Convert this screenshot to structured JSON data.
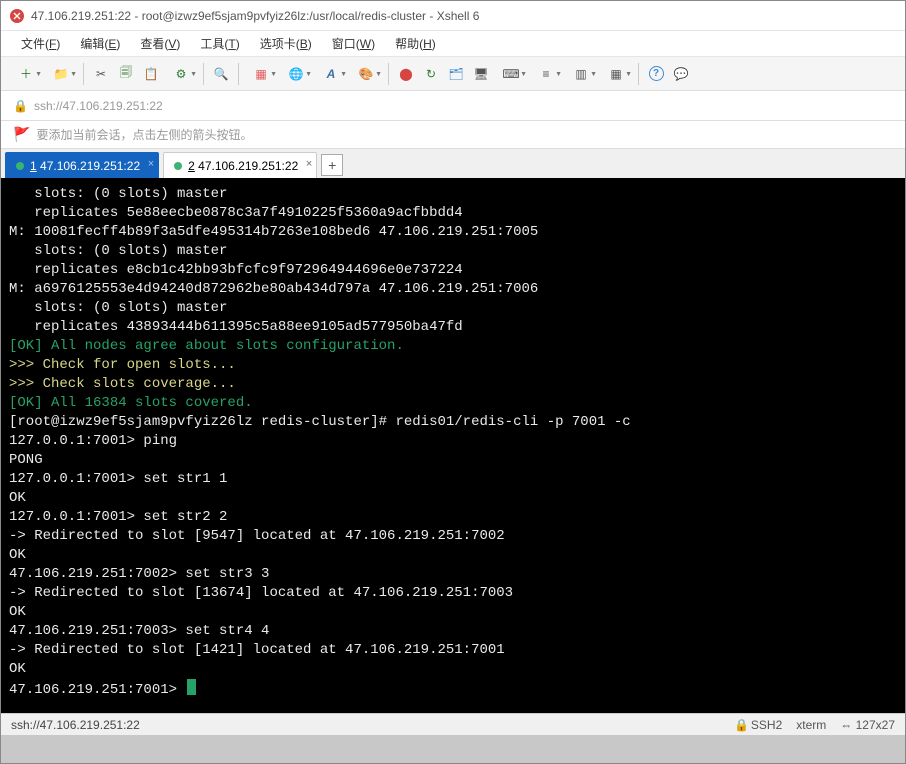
{
  "window": {
    "title": "47.106.219.251:22 - root@izwz9ef5sjam9pvfyiz26lz:/usr/local/redis-cluster - Xshell 6"
  },
  "menu": {
    "file": {
      "pre": "文件(",
      "key": "F",
      "post": ")"
    },
    "edit": {
      "pre": "编辑(",
      "key": "E",
      "post": ")"
    },
    "view": {
      "pre": "查看(",
      "key": "V",
      "post": ")"
    },
    "tools": {
      "pre": "工具(",
      "key": "T",
      "post": ")"
    },
    "tabs": {
      "pre": "选项卡(",
      "key": "B",
      "post": ")"
    },
    "window": {
      "pre": "窗口(",
      "key": "W",
      "post": ")"
    },
    "help": {
      "pre": "帮助(",
      "key": "H",
      "post": ")"
    }
  },
  "addressbar": {
    "url": "ssh://47.106.219.251:22"
  },
  "hint": {
    "text": "要添加当前会话，点击左侧的箭头按钮。"
  },
  "tabs": [
    {
      "num": "1",
      "label": " 47.106.219.251:22",
      "active": true
    },
    {
      "num": "2",
      "label": " 47.106.219.251:22",
      "active": false
    }
  ],
  "terminal": {
    "lines": [
      {
        "cls": "w",
        "text": "   slots: (0 slots) master"
      },
      {
        "cls": "w",
        "text": "   replicates 5e88eecbe0878c3a7f4910225f5360a9acfbbdd4"
      },
      {
        "cls": "w",
        "text": "M: 10081fecff4b89f3a5dfe495314b7263e108bed6 47.106.219.251:7005"
      },
      {
        "cls": "w",
        "text": "   slots: (0 slots) master"
      },
      {
        "cls": "w",
        "text": "   replicates e8cb1c42bb93bfcfc9f972964944696e0e737224"
      },
      {
        "cls": "w",
        "text": "M: a6976125553e4d94240d872962be80ab434d797a 47.106.219.251:7006"
      },
      {
        "cls": "w",
        "text": "   slots: (0 slots) master"
      },
      {
        "cls": "w",
        "text": "   replicates 43893444b611395c5a88ee9105ad577950ba47fd"
      },
      {
        "cls": "grn",
        "text": "[OK] All nodes agree about slots configuration."
      },
      {
        "cls": "yel",
        "text": ">>> Check for open slots..."
      },
      {
        "cls": "yel",
        "text": ">>> Check slots coverage..."
      },
      {
        "cls": "grn",
        "text": "[OK] All 16384 slots covered."
      },
      {
        "cls": "w",
        "text": "[root@izwz9ef5sjam9pvfyiz26lz redis-cluster]# redis01/redis-cli -p 7001 -c"
      },
      {
        "cls": "w",
        "text": "127.0.0.1:7001> ping"
      },
      {
        "cls": "w",
        "text": "PONG"
      },
      {
        "cls": "w",
        "text": "127.0.0.1:7001> set str1 1"
      },
      {
        "cls": "w",
        "text": "OK"
      },
      {
        "cls": "w",
        "text": "127.0.0.1:7001> set str2 2"
      },
      {
        "cls": "w",
        "text": "-> Redirected to slot [9547] located at 47.106.219.251:7002"
      },
      {
        "cls": "w",
        "text": "OK"
      },
      {
        "cls": "w",
        "text": "47.106.219.251:7002> set str3 3"
      },
      {
        "cls": "w",
        "text": "-> Redirected to slot [13674] located at 47.106.219.251:7003"
      },
      {
        "cls": "w",
        "text": "OK"
      },
      {
        "cls": "w",
        "text": "47.106.219.251:7003> set str4 4"
      },
      {
        "cls": "w",
        "text": "-> Redirected to slot [1421] located at 47.106.219.251:7001"
      },
      {
        "cls": "w",
        "text": "OK"
      },
      {
        "cls": "w",
        "text": "47.106.219.251:7001> ",
        "cursor": true
      }
    ]
  },
  "status": {
    "left": "ssh://47.106.219.251:22",
    "ssh": "SSH2",
    "term": "xterm",
    "size": "127x27"
  },
  "icons": {
    "new": "＋",
    "open": "📁",
    "cut": "✂",
    "copy": "🗐",
    "paste": "📋",
    "props": "⚙",
    "find": "🔍",
    "layout": "▦",
    "globe": "🌐",
    "font": "A",
    "style": "🎨",
    "rec": "⬤",
    "stop": "↻",
    "filemgr": "🗂",
    "server": "🖥",
    "keyb": "⌨",
    "align": "≡",
    "split": "▥",
    "grid": "▦",
    "help": "?",
    "chat": "💬",
    "lock": "🔒",
    "flag": "🚩"
  }
}
